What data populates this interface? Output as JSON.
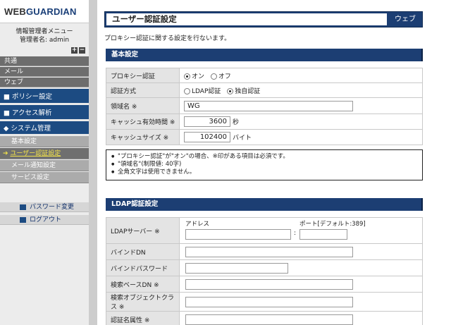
{
  "logo": {
    "prefix": "WEB",
    "suffix": "GUARDIAN"
  },
  "admin": {
    "line1": "情報管理者メニュー",
    "line2": "管理者名: admin"
  },
  "controls": {
    "plus": "+",
    "minus": "−"
  },
  "nav": {
    "top": [
      "共通",
      "メール",
      "ウェブ"
    ],
    "blue": [
      "■ ポリシー設定",
      "■ アクセス解析",
      "◆ システム管理"
    ],
    "sub": [
      "基本設定",
      "ユーザー認証設定",
      "メール通知設定",
      "サービス設定"
    ],
    "bottom": [
      "パスワード変更",
      "ログアウト"
    ]
  },
  "page": {
    "title": "ユーザー認証設定",
    "tab": "ウェブ",
    "description": "プロキシー認証に関する設定を行ないます。"
  },
  "basic": {
    "heading": "基本設定",
    "proxy_auth": {
      "label": "プロキシー認証",
      "options": [
        "オン",
        "オフ"
      ],
      "selected": "オン"
    },
    "auth_method": {
      "label": "認証方式",
      "options": [
        "LDAP認証",
        "独自認証"
      ],
      "selected": "独自認証"
    },
    "realm": {
      "label": "領域名 ※",
      "value": "WG"
    },
    "cache_time": {
      "label": "キャッシュ有効時間 ※",
      "value": "3600",
      "unit": "秒"
    },
    "cache_size": {
      "label": "キャッシュサイズ ※",
      "value": "102400",
      "unit": "バイト"
    },
    "notes": [
      "\"プロキシー認証\"が\"オン\"の場合、※印がある項目は必須です。",
      "\"領域名\"(制限値: 40字)",
      "全角文字は使用できません。"
    ]
  },
  "ldap": {
    "heading": "LDAP認証設定",
    "server": {
      "label": "LDAPサーバー ※",
      "address_label": "アドレス",
      "port_label": "ポート[デフォルト:389]",
      "separator": ":",
      "address": "",
      "port": ""
    },
    "bind_dn": {
      "label": "バインドDN",
      "value": ""
    },
    "bind_password": {
      "label": "バインドパスワード",
      "value": ""
    },
    "search_base_dn": {
      "label": "検索ベースDN ※",
      "value": ""
    },
    "search_object_class": {
      "label": "検索オブジェクトクラス ※",
      "value": ""
    },
    "auth_attr": {
      "label": "認証名属性 ※",
      "value": ""
    }
  }
}
